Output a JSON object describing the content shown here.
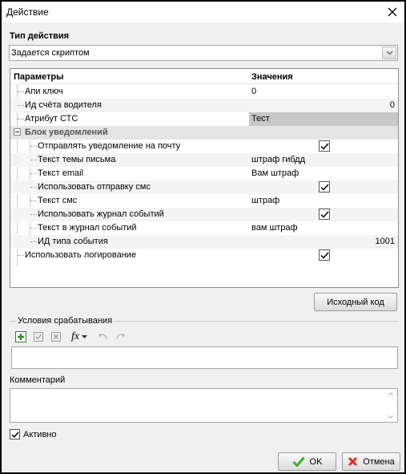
{
  "window": {
    "title": "Действие"
  },
  "action_type": {
    "label": "Тип действия",
    "value": "Задается скриптом"
  },
  "grid": {
    "col_params": "Параметры",
    "col_values": "Значения",
    "rows": [
      {
        "name": "Апи ключ",
        "value": "0"
      },
      {
        "name": "Ид счёта водителя",
        "value": "0"
      },
      {
        "name": "Атрибут СТС",
        "value": "Тест"
      },
      {
        "name": "Блок уведомлений"
      },
      {
        "name": "Отправлять уведомление на почту",
        "checked": true
      },
      {
        "name": "Текст темы письма",
        "value": "штраф гибдд"
      },
      {
        "name": "Текст email",
        "value": "Вам штраф"
      },
      {
        "name": "Использовать отправку смс",
        "checked": true
      },
      {
        "name": "Текст смс",
        "value": "штраф"
      },
      {
        "name": "Использовать журнал событий",
        "checked": true
      },
      {
        "name": "Текст в журнал событий",
        "value": "вам штраф"
      },
      {
        "name": "ИД типа события",
        "value": "1001"
      },
      {
        "name": "Использовать логирование",
        "checked": true
      }
    ]
  },
  "source_button": "Исходный код",
  "conditions": {
    "label": "Условия срабатывания",
    "fx": "fx"
  },
  "comment": {
    "label": "Комментарий"
  },
  "active": {
    "label": "Активно",
    "checked": true
  },
  "buttons": {
    "ok": "OK",
    "cancel": "Отмена"
  }
}
